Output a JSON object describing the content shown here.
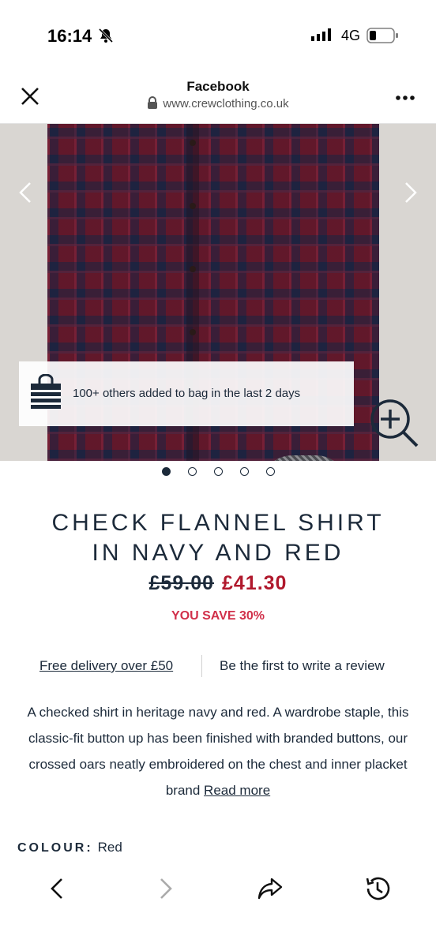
{
  "status_bar": {
    "time": "16:14",
    "network": "4G"
  },
  "browser": {
    "title": "Facebook",
    "url": "www.crewclothing.co.uk"
  },
  "social_proof": "100+ others added to bag in the last 2 days",
  "carousel": {
    "count": 5,
    "active": 1
  },
  "product": {
    "title_line1": "CHECK FLANNEL SHIRT",
    "title_line2": "IN NAVY AND RED",
    "old_price": "£59.00",
    "new_price": "£41.30",
    "saving": "YOU SAVE 30%"
  },
  "links": {
    "delivery": "Free delivery over £50",
    "review": "Be the first to write a review"
  },
  "description": {
    "text": "A checked shirt in heritage navy and red. A wardrobe staple, this classic-fit button up has been finished with branded buttons, our crossed oars neatly embroidered on the chest and inner placket brand ",
    "read_more": "Read more"
  },
  "colour": {
    "label": "COLOUR:",
    "value": "Red"
  },
  "colors": {
    "navy": "#1c2a3a",
    "sale_red": "#b0182c",
    "save_pink": "#d1304a"
  },
  "icons": [
    "bell-slash-icon",
    "signal-icon",
    "battery-icon",
    "close-icon",
    "lock-icon",
    "more-icon",
    "chevron-left-icon",
    "chevron-right-icon",
    "shopping-bag-icon",
    "zoom-in-icon",
    "back-icon",
    "forward-icon",
    "share-icon",
    "history-icon"
  ]
}
